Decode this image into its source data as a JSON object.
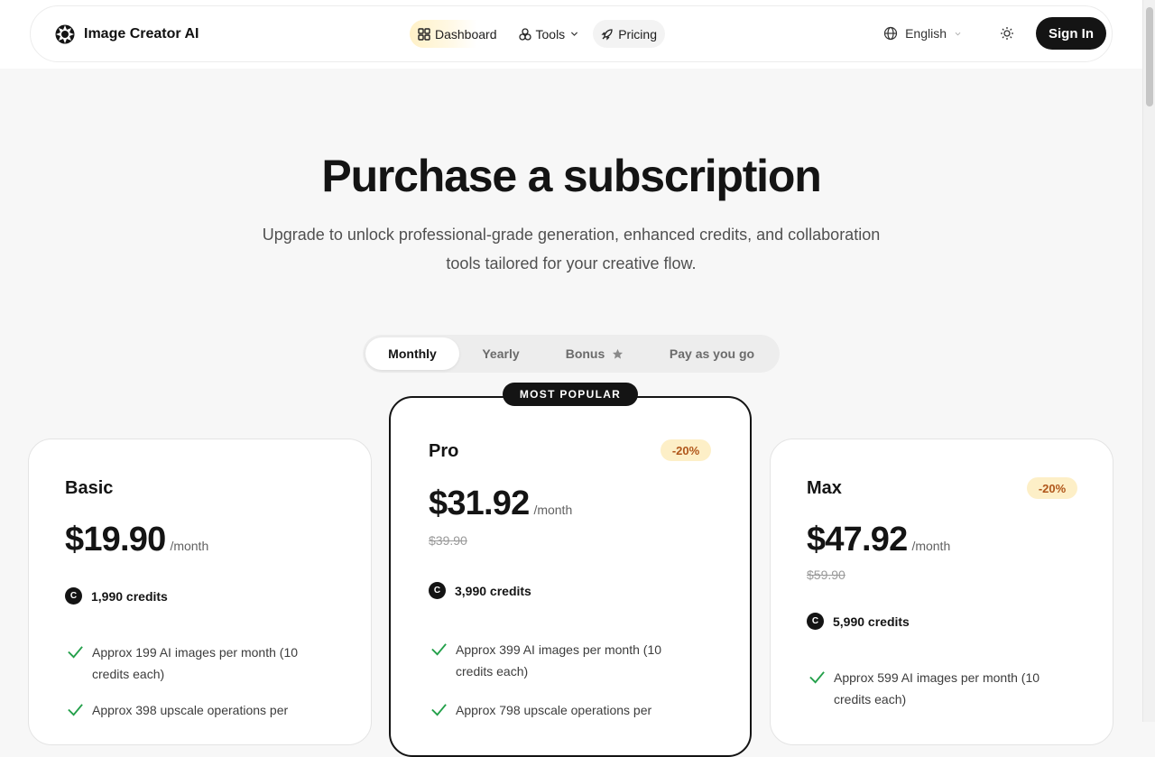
{
  "brand": {
    "name": "Image Creator AI"
  },
  "nav": {
    "items": [
      {
        "label": "Dashboard",
        "icon": "grid-icon"
      },
      {
        "label": "Tools",
        "icon": "shapes-icon"
      },
      {
        "label": "Pricing",
        "icon": "rocket-icon"
      }
    ],
    "language": "English",
    "sign_in": "Sign In"
  },
  "hero": {
    "title": "Purchase a subscription",
    "subtitle_line1": "Upgrade to unlock professional-grade generation, enhanced credits, and collaboration",
    "subtitle_line2": "tools tailored for your creative flow."
  },
  "billing_tabs": [
    {
      "label": "Monthly",
      "active": true
    },
    {
      "label": "Yearly",
      "active": false
    },
    {
      "label": "Bonus",
      "active": false
    },
    {
      "label": "Pay as you go",
      "active": false
    }
  ],
  "plans": [
    {
      "name": "Basic",
      "price": "$19.90",
      "period": "/month",
      "credits": "1,990 credits",
      "features": [
        [
          "Approx 199 AI images per month (10",
          "credits each)"
        ],
        [
          "Approx 398 upscale operations per",
          ""
        ]
      ]
    },
    {
      "name": "Pro",
      "badge": "MOST POPULAR",
      "discount": "-20%",
      "price": "$31.92",
      "period": "/month",
      "old_price": "$39.90",
      "credits": "3,990 credits",
      "features": [
        [
          "Approx 399 AI images per month (10",
          "credits each)"
        ],
        [
          "Approx 798 upscale operations per",
          ""
        ]
      ]
    },
    {
      "name": "Max",
      "discount": "-20%",
      "price": "$47.92",
      "period": "/month",
      "old_price": "$59.90",
      "credits": "5,990 credits",
      "features": [
        [
          "Approx 599 AI images per month (10",
          "credits each)"
        ]
      ]
    }
  ],
  "coin_symbol": "C",
  "colors": {
    "accent_dark": "#141414",
    "check_green": "#23a04a",
    "discount_bg": "#fdefc7",
    "discount_text": "#b0561a"
  }
}
